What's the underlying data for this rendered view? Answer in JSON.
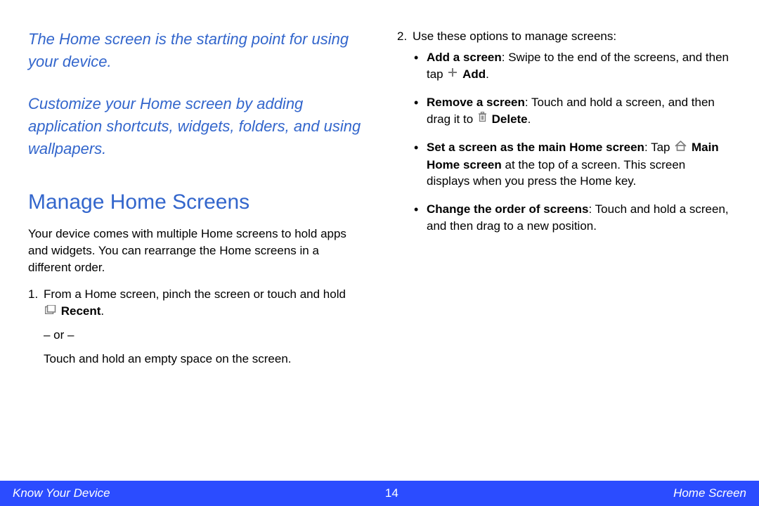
{
  "left": {
    "intro1": "The Home screen is the starting point for using your device.",
    "intro2": "Customize your Home screen by adding application shortcuts, widgets, folders, and using wallpapers.",
    "sectionTitle": "Manage Home Screens",
    "sectionPara": "Your device comes with multiple Home screens to hold apps and widgets. You can rearrange the Home screens in a different order.",
    "step1a": "From a Home screen, pinch the screen or touch and hold ",
    "step1b": "Recent",
    "step1or": "– or –",
    "step1c": "Touch and hold an empty space on the screen.",
    "step1dot": "."
  },
  "right": {
    "step2Intro": "Use these options to manage screens:",
    "b1Label": "Add a screen",
    "b1a": ": Swipe to the end of the screens, and then tap ",
    "b1b": "Add",
    "b1c": ".",
    "b2Label": "Remove a screen",
    "b2a": ": Touch and hold a screen, and then drag it to ",
    "b2b": "Delete",
    "b2c": ".",
    "b3Label": "Set a screen as the main Home screen",
    "b3a": ": Tap ",
    "b3b": "Main Home screen",
    "b3c": " at the top of a screen. This screen displays when you press the Home key.",
    "b4Label": "Change the order of screens",
    "b4a": ": Touch and hold a screen, and then drag to a new position."
  },
  "footer": {
    "left": "Know Your Device",
    "page": "14",
    "right": "Home Screen"
  }
}
